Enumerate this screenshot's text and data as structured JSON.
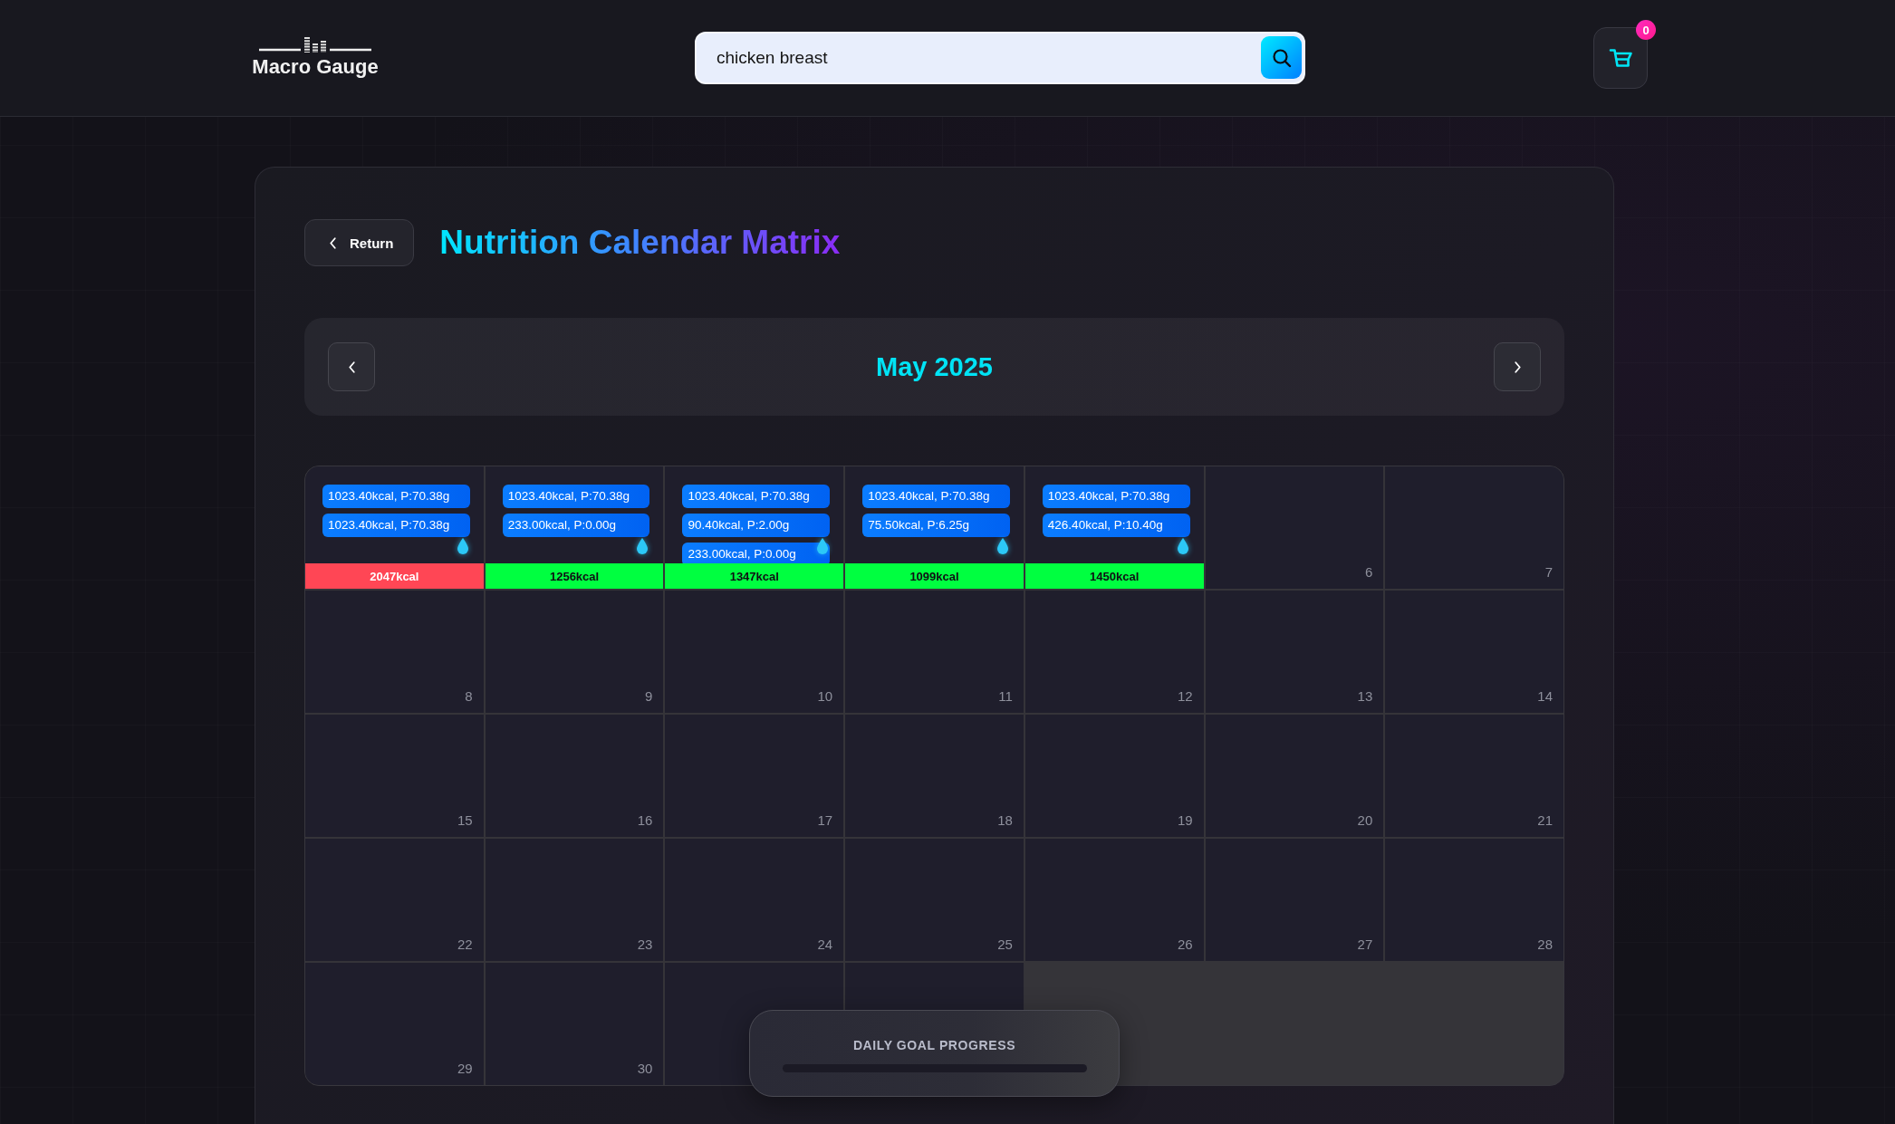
{
  "header": {
    "logo": {
      "text": "Macro Gauge"
    },
    "search": {
      "value": "chicken breast"
    },
    "cart": {
      "count": "0"
    }
  },
  "page": {
    "return_label": "Return",
    "title": "Nutrition Calendar Matrix"
  },
  "calendar": {
    "month": "May 2025",
    "cells": [
      {
        "entries": [
          "1023.40kcal, P:70.38g",
          "1023.40kcal, P:70.38g"
        ],
        "total": "2047kcal",
        "over_goal": true
      },
      {
        "entries": [
          "1023.40kcal, P:70.38g",
          "233.00kcal, P:0.00g"
        ],
        "total": "1256kcal",
        "over_goal": false
      },
      {
        "entries": [
          "1023.40kcal, P:70.38g",
          "90.40kcal, P:2.00g",
          "233.00kcal, P:0.00g"
        ],
        "total": "1347kcal",
        "over_goal": false
      },
      {
        "entries": [
          "1023.40kcal, P:70.38g",
          "75.50kcal, P:6.25g"
        ],
        "total": "1099kcal",
        "over_goal": false
      },
      {
        "entries": [
          "1023.40kcal, P:70.38g",
          "426.40kcal, P:10.40g"
        ],
        "total": "1450kcal",
        "over_goal": false
      },
      {
        "number": "6"
      },
      {
        "number": "7"
      },
      {
        "number": "8"
      },
      {
        "number": "9"
      },
      {
        "number": "10"
      },
      {
        "number": "11"
      },
      {
        "number": "12"
      },
      {
        "number": "13"
      },
      {
        "number": "14"
      },
      {
        "number": "15"
      },
      {
        "number": "16"
      },
      {
        "number": "17"
      },
      {
        "number": "18"
      },
      {
        "number": "19"
      },
      {
        "number": "20"
      },
      {
        "number": "21"
      },
      {
        "number": "22"
      },
      {
        "number": "23"
      },
      {
        "number": "24"
      },
      {
        "number": "25"
      },
      {
        "number": "26"
      },
      {
        "number": "27"
      },
      {
        "number": "28"
      },
      {
        "number": "29"
      },
      {
        "number": "30"
      },
      {},
      {}
    ]
  },
  "progress_popup": {
    "label": "DAILY GOAL PROGRESS",
    "level": 0
  }
}
